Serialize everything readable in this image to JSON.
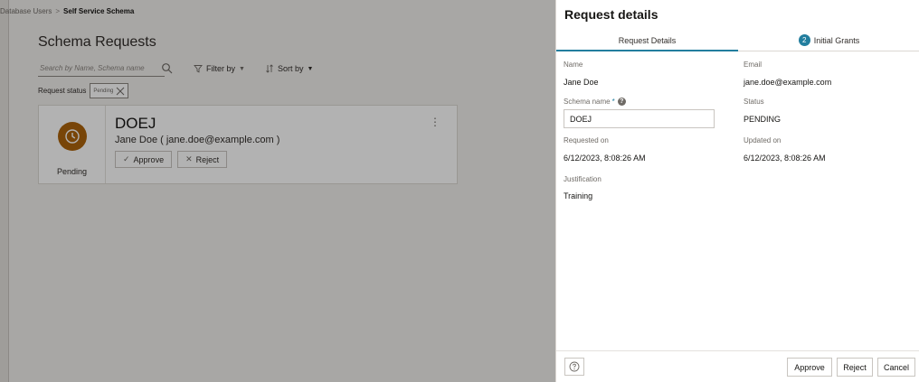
{
  "breadcrumb": {
    "parent": "Database Users",
    "separator": ">",
    "current": "Self Service Schema"
  },
  "page": {
    "title": "Schema Requests",
    "search_placeholder": "Search by Name, Schema name",
    "filter_label": "Filter by",
    "sort_label": "Sort by",
    "request_status_label": "Request status",
    "status_chip": "Pending"
  },
  "card": {
    "title": "DOEJ",
    "subtitle": "Jane Doe ( jane.doe@example.com )",
    "status": "Pending",
    "approve_label": "Approve",
    "reject_label": "Reject",
    "status_color": "#ac630c"
  },
  "drawer": {
    "title": "Request details",
    "tabs": [
      {
        "label": "Request Details",
        "active": true
      },
      {
        "label": "Initial Grants",
        "badge": "2",
        "active": false
      }
    ],
    "fields": {
      "name_label": "Name",
      "name_value": "Jane Doe",
      "email_label": "Email",
      "email_value": "jane.doe@example.com",
      "schema_label": "Schema name",
      "schema_required": "*",
      "schema_value": "DOEJ",
      "status_label": "Status",
      "status_value": "PENDING",
      "requested_label": "Requested on",
      "requested_value": "6/12/2023, 8:08:26 AM",
      "updated_label": "Updated on",
      "updated_value": "6/12/2023, 8:08:26 AM",
      "justification_label": "Justification",
      "justification_value": "Training"
    },
    "footer": {
      "approve_label": "Approve",
      "reject_label": "Reject",
      "cancel_label": "Cancel"
    },
    "accent_color": "#227e9e"
  }
}
